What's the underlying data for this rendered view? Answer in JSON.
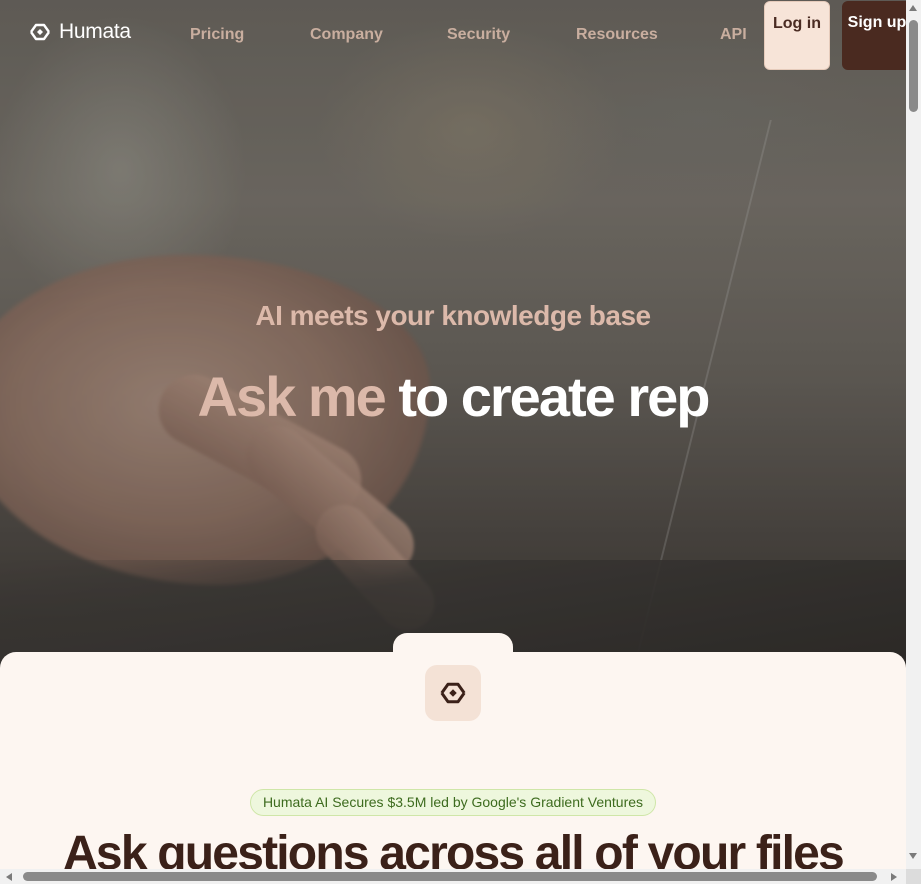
{
  "brand": {
    "name": "Humata",
    "logo_icon": "humata-logo-icon"
  },
  "nav": {
    "links": [
      "Pricing",
      "Company",
      "Security",
      "Resources",
      "API"
    ],
    "login_label": "Log in",
    "signup_label": "Sign up"
  },
  "hero": {
    "tagline": "AI meets your knowledge base",
    "headline_accent": "Ask me",
    "headline_main": "to create rep"
  },
  "content": {
    "announcement": "Humata AI Secures $3.5M led by Google's Gradient Ventures",
    "section_title": "Ask questions across all of your files"
  },
  "colors": {
    "accent_text": "#dcb9aa",
    "brand_dark": "#4a2a20",
    "login_bg": "#f7e4d8",
    "page_bg": "#fdf6f1",
    "announcement_bg": "#eef7dd",
    "announcement_text": "#3d6b1e"
  }
}
